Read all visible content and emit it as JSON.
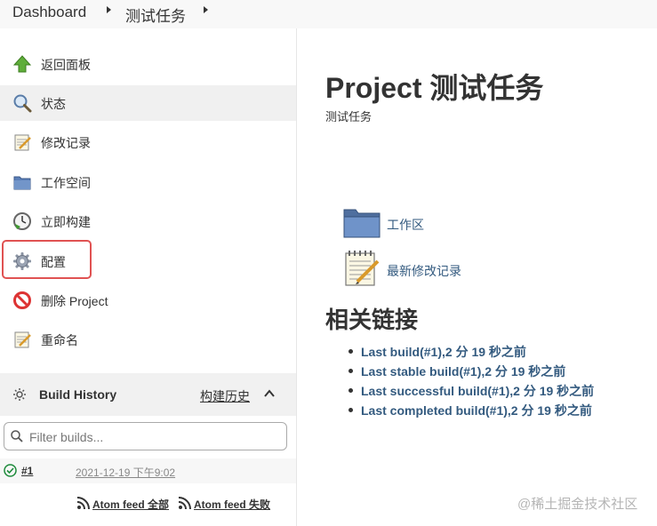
{
  "breadcrumb": {
    "root": "Dashboard",
    "job": "测试任务"
  },
  "sidebar": {
    "items": [
      {
        "label": "返回面板",
        "icon": "up-arrow-icon"
      },
      {
        "label": "状态",
        "icon": "search-icon"
      },
      {
        "label": "修改记录",
        "icon": "notepad-icon"
      },
      {
        "label": "工作空间",
        "icon": "folder-icon"
      },
      {
        "label": "立即构建",
        "icon": "clock-icon"
      },
      {
        "label": "配置",
        "icon": "gear-icon"
      },
      {
        "label": "删除 Project",
        "icon": "no-entry-icon"
      },
      {
        "label": "重命名",
        "icon": "notepad-icon"
      }
    ],
    "build_history": {
      "title": "Build History",
      "title_cn": "构建历史",
      "filter_placeholder": "Filter builds...",
      "builds": [
        {
          "number": "#1",
          "time": "2021-12-19 下午9:02",
          "status": "success"
        }
      ],
      "feed_all": "Atom feed 全部",
      "feed_failed": "Atom feed 失败"
    }
  },
  "main": {
    "title": "Project 测试任务",
    "description": "测试任务",
    "workspace_link": "工作区",
    "changes_link": "最新修改记录",
    "related_heading": "相关链接",
    "related_links": [
      "Last build(#1),2 分 19 秒之前",
      "Last stable build(#1),2 分 19 秒之前",
      "Last successful build(#1),2 分 19 秒之前",
      "Last completed build(#1),2 分 19 秒之前"
    ]
  },
  "watermark": "@稀土掘金技术社区",
  "colors": {
    "link": "#335a7f",
    "highlight_border": "#e05252",
    "success": "#1c8a3a"
  }
}
